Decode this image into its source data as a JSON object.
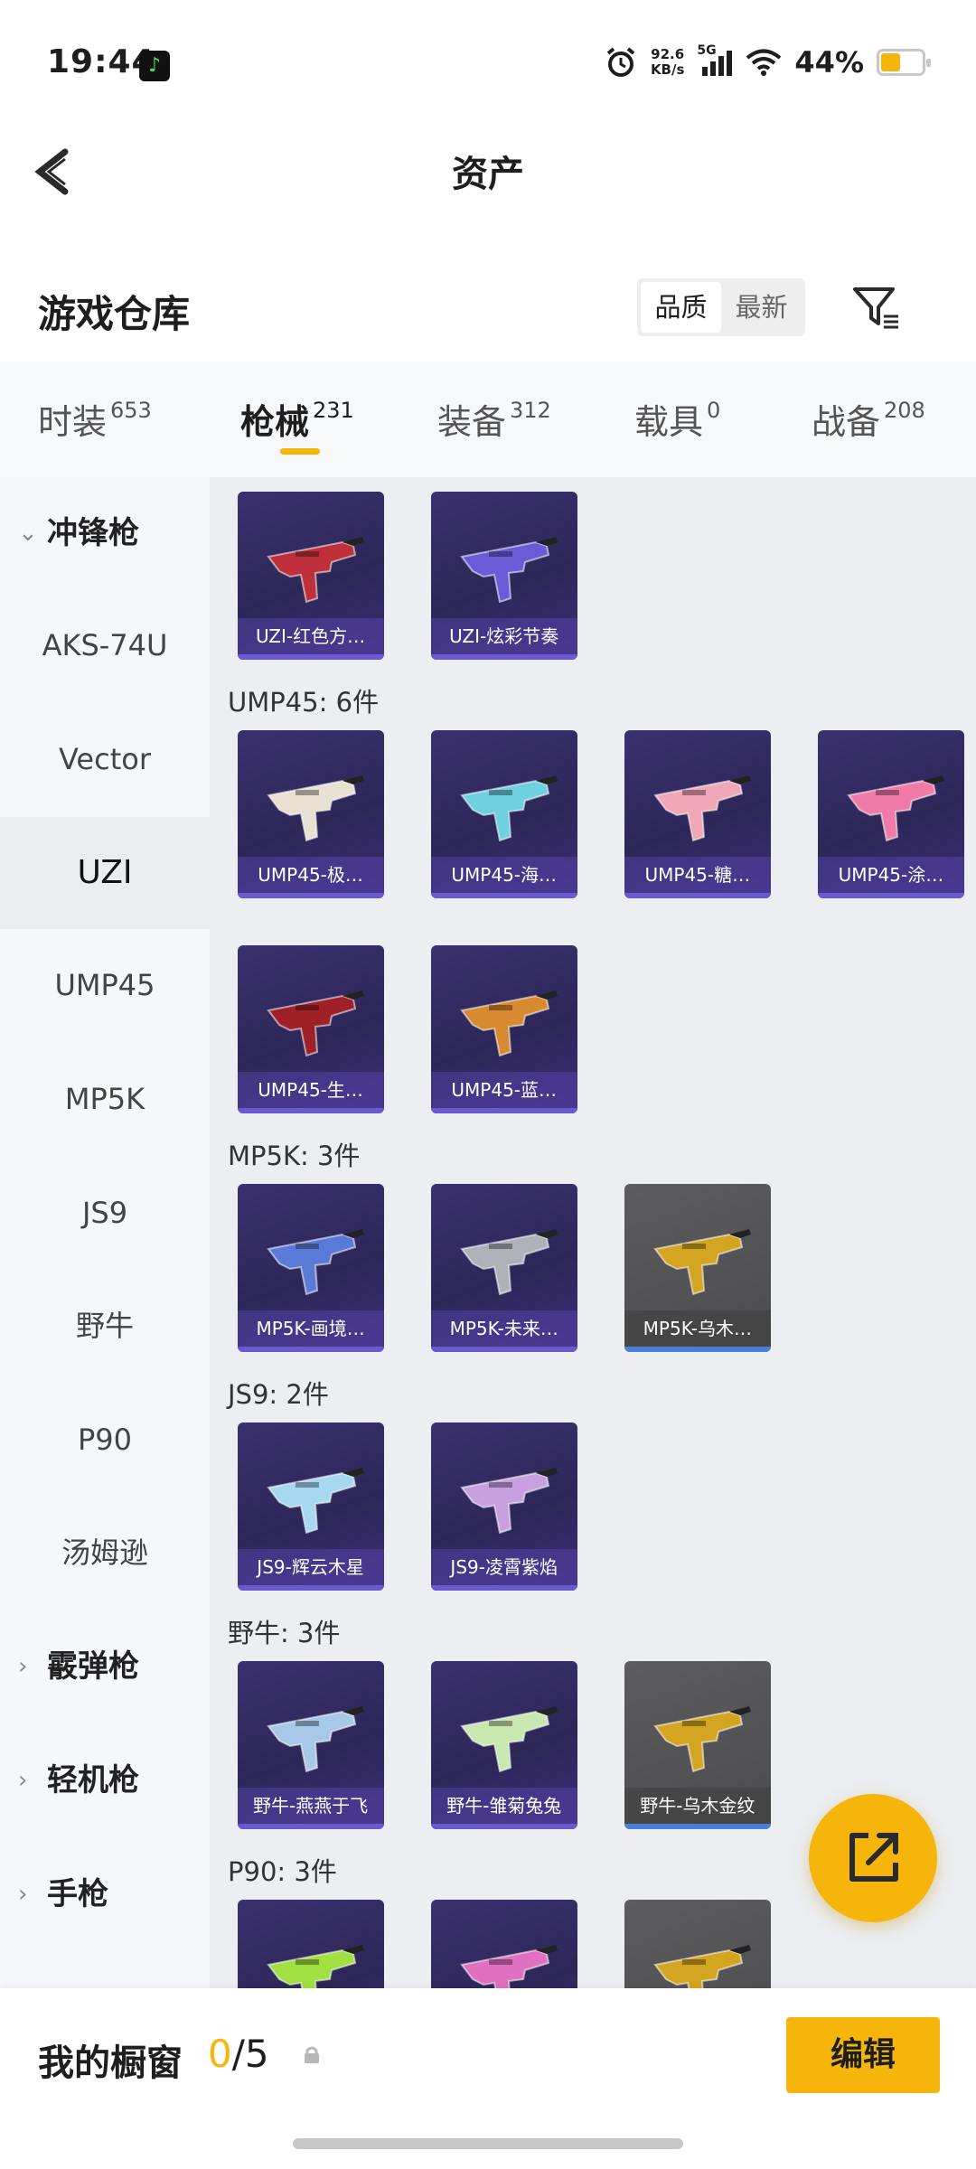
{
  "status": {
    "time": "19:44",
    "net_speed": "92.6",
    "net_unit": "KB/s",
    "net_type": "5G",
    "battery": "44%",
    "battery_level": 0.44,
    "app_icon": "music-app-icon"
  },
  "header": {
    "title": "资产",
    "back_icon": "chevron-left-icon"
  },
  "warehouse": {
    "title": "游戏仓库",
    "sort_options": [
      "品质",
      "最新"
    ],
    "sort_selected": "品质",
    "filter_icon": "filter-icon"
  },
  "tabs": [
    {
      "label": "时装",
      "count": "653"
    },
    {
      "label": "枪械",
      "count": "231",
      "active": true
    },
    {
      "label": "装备",
      "count": "312"
    },
    {
      "label": "载具",
      "count": "0"
    },
    {
      "label": "战备",
      "count": "208"
    }
  ],
  "sidebar": {
    "groups": [
      {
        "label": "冲锋枪",
        "expanded": true
      },
      {
        "label": "霰弹枪",
        "expanded": false
      },
      {
        "label": "轻机枪",
        "expanded": false
      },
      {
        "label": "手枪",
        "expanded": false
      }
    ],
    "items": [
      "AKS-74U",
      "Vector",
      "UZI",
      "UMP45",
      "MP5K",
      "JS9",
      "野牛",
      "P90",
      "汤姆逊"
    ],
    "selected": "UZI"
  },
  "sections": [
    {
      "title": "",
      "cards": [
        {
          "label": "UZI-红色方…",
          "color": "#c0303a"
        },
        {
          "label": "UZI-炫彩节奏",
          "color": "#6b5bd6"
        }
      ]
    },
    {
      "title": "UMP45: 6件",
      "cards": [
        {
          "label": "UMP45-极…",
          "color": "#e8e0d0"
        },
        {
          "label": "UMP45-海…",
          "color": "#6fd0e0"
        },
        {
          "label": "UMP45-糖…",
          "color": "#f0a8b8"
        },
        {
          "label": "UMP45-涂…",
          "color": "#f07aa8"
        },
        {
          "label": "UMP45-生…",
          "color": "#a02028"
        },
        {
          "label": "UMP45-蓝…",
          "color": "#d88a30"
        }
      ]
    },
    {
      "title": "MP5K: 3件",
      "cards": [
        {
          "label": "MP5K-画境…",
          "color": "#5a7ad8"
        },
        {
          "label": "MP5K-未来…",
          "color": "#b0b0b8"
        },
        {
          "label": "MP5K-乌木…",
          "color": "#d4a520",
          "gray": true
        }
      ]
    },
    {
      "title": "JS9: 2件",
      "cards": [
        {
          "label": "JS9-辉云木星",
          "color": "#a8d8f0"
        },
        {
          "label": "JS9-凌霄紫焰",
          "color": "#c8a0e0"
        }
      ]
    },
    {
      "title": "野牛: 3件",
      "cards": [
        {
          "label": "野牛-燕燕于飞",
          "color": "#a8c8e8"
        },
        {
          "label": "野牛-雏菊兔兔",
          "color": "#c8e8b0"
        },
        {
          "label": "野牛-乌木金纹",
          "color": "#d4a520",
          "gray": true
        }
      ]
    },
    {
      "title": "P90: 3件",
      "cards": [
        {
          "label": "",
          "color": "#a0e040"
        },
        {
          "label": "",
          "color": "#e070c0"
        },
        {
          "label": "",
          "color": "#d4a520",
          "gray": true
        }
      ]
    }
  ],
  "fab": {
    "icon": "external-link-icon"
  },
  "bottom": {
    "showcase_label": "我的橱窗",
    "showcase_current": "0",
    "showcase_total": "/5",
    "lock_icon": "lock-icon",
    "edit_label": "编辑"
  },
  "colors": {
    "accent": "#f5b50a",
    "card_bg": "#2d2758",
    "card_bar": "#6a5acd"
  }
}
